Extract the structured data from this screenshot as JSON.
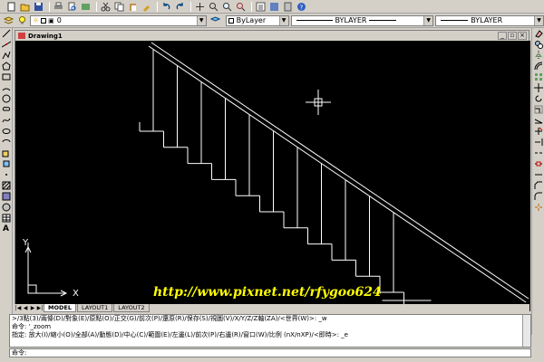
{
  "toolbar2": {
    "layer_value": "0",
    "color_value": "ByLayer",
    "linetype_value": "BYLAYER",
    "lineweight_value": "BYLAYER"
  },
  "window": {
    "title": "Drawing1"
  },
  "canvas": {
    "watermark": "http://www.pixnet.net/rfygoo624",
    "axis_x": "X",
    "axis_y": "Y",
    "background": "#000000",
    "line_color": "#ffffff",
    "watermark_color": "#ffff00"
  },
  "layout_tabs": [
    {
      "label": "MODEL",
      "active": true
    },
    {
      "label": "LAYOUT1",
      "active": false
    },
    {
      "label": "LAYOUT2",
      "active": false
    }
  ],
  "command": {
    "lines": [
      ">/3點(3)/兩條(D)/對象(E)/原點(O)/正交(G)/前次(P)/還原(R)/保存(S)/視圖(V)/X/Y/Z/Z軸(ZA)/<世界(W)>: _w",
      "命令: '_zoom",
      "指定: 放大(I)/縮小(O)/全部(A)/動態(D)/中心(C)/範圍(E)/左邊(L)/前次(P)/右邊(R)/窗口(W)/比例 (nX/nXP)/<即時>: _e"
    ],
    "prompt": "命令:"
  }
}
